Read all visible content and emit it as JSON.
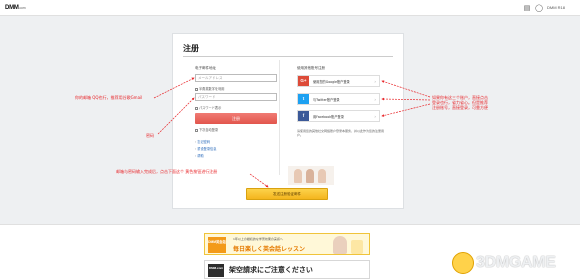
{
  "topbar": {
    "logo": "DMM",
    "logo_suffix": ".com",
    "lang": "DMM R18"
  },
  "card": {
    "title": "注册",
    "left": {
      "section": "电子邮件地址",
      "email_placeholder": "メールアドレス",
      "check1": "半角英数字を利用",
      "password_placeholder": "パスワード",
      "check2": "パスワード表示",
      "submit": "注册",
      "check3": "下次自动登录",
      "links": [
        "忘记密码",
        "重设登录信息",
        "帮助"
      ]
    },
    "right": {
      "section": "使用其他账号注册",
      "social": [
        {
          "icon": "G+",
          "label": "使用您的Google账户登录",
          "color": "#dd4b39"
        },
        {
          "icon": "t",
          "label": "与Twitter账户登录",
          "color": "#1da1f2"
        },
        {
          "icon": "f",
          "label": "用Facebook账户登录",
          "color": "#3b5998"
        }
      ],
      "note": "请使用您的其他社交网络账户登录本服务，并以此作为您的注册用户。"
    },
    "yellow_button": "发送注册验证邮件"
  },
  "annotations": {
    "email": "你的邮箱  QQ也行，推荐用谷歌Gmail",
    "password": "密码",
    "social": "如果你有这三个账户，直接点击登录也行，省力省心。但是推荐注册账号，直接登录，可靠方便",
    "confirm": "邮箱与密码输入完成后，点击下面这个    黄色按钮进行注册"
  },
  "bottom": {
    "banner1_small": "1年以上の継続的な学習効果の実感へ",
    "banner1_big": "毎日楽しく英会話レッスン",
    "banner1_badge": "DMM英会話",
    "banner2_badge": "DMM.com",
    "banner2_text": "架空請求にご注意ください"
  },
  "watermark": "3DMGAME"
}
